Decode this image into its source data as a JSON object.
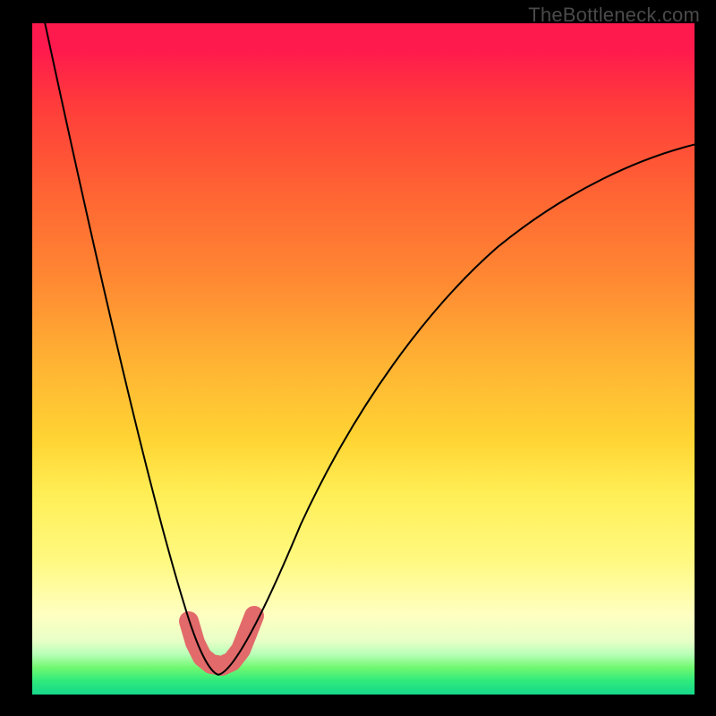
{
  "watermark": "TheBottleneck.com",
  "chart_data": {
    "type": "line",
    "title": "",
    "xlabel": "",
    "ylabel": "",
    "xlim": [
      0,
      100
    ],
    "ylim": [
      0,
      100
    ],
    "series": [
      {
        "name": "bottleneck-curve",
        "x": [
          0,
          5,
          10,
          15,
          18,
          20,
          22,
          24,
          26,
          28,
          30,
          33,
          36,
          40,
          45,
          50,
          55,
          60,
          65,
          70,
          75,
          80,
          85,
          90,
          95,
          100
        ],
        "values": [
          100,
          82,
          64,
          44,
          30,
          20,
          11,
          5,
          1,
          0,
          1,
          6,
          14,
          24,
          34,
          43,
          50,
          56,
          61,
          65,
          69,
          72,
          75,
          77,
          79,
          80
        ]
      }
    ],
    "annotations": [
      {
        "name": "optimal-zone-marker",
        "type": "highlight",
        "x_range": [
          23,
          32
        ],
        "color": "#e26a6a"
      }
    ]
  }
}
